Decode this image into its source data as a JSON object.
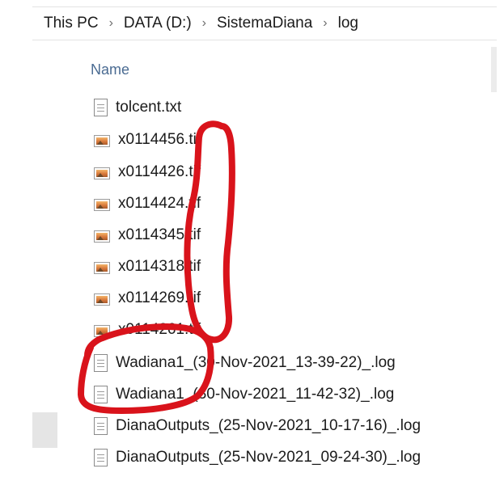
{
  "breadcrumb": {
    "items": [
      "This PC",
      "DATA (D:)",
      "SistemaDiana",
      "log"
    ],
    "separator": "›"
  },
  "column_header": "Name",
  "files": [
    {
      "name": "tolcent.txt",
      "icon": "text-file-icon"
    },
    {
      "name": "x0114456.tif",
      "icon": "image-file-icon"
    },
    {
      "name": "x0114426.tif",
      "icon": "image-file-icon"
    },
    {
      "name": "x0114424.tif",
      "icon": "image-file-icon"
    },
    {
      "name": "x0114345.tif",
      "icon": "image-file-icon"
    },
    {
      "name": "x0114318.tif",
      "icon": "image-file-icon"
    },
    {
      "name": "x0114269.tif",
      "icon": "image-file-icon"
    },
    {
      "name": "x0114261.tif",
      "icon": "image-file-icon"
    },
    {
      "name": "Wadiana1_(30-Nov-2021_13-39-22)_.log",
      "icon": "log-file-icon"
    },
    {
      "name": "Wadiana1_(30-Nov-2021_11-42-32)_.log",
      "icon": "log-file-icon"
    },
    {
      "name": "DianaOutputs_(25-Nov-2021_10-17-16)_.log",
      "icon": "log-file-icon"
    },
    {
      "name": "DianaOutputs_(25-Nov-2021_09-24-30)_.log",
      "icon": "log-file-icon"
    }
  ],
  "annotation_color": "#d9131b"
}
